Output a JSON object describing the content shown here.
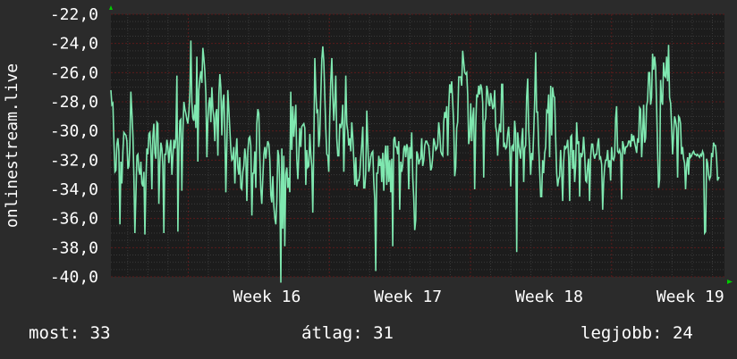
{
  "chart_data": {
    "type": "line",
    "ylabel": "onlinestream.live",
    "ylim": [
      -40,
      -22
    ],
    "yticks": [
      "-22,0",
      "-24,0",
      "-26,0",
      "-28,0",
      "-30,0",
      "-32,0",
      "-34,0",
      "-36,0",
      "-38,0",
      "-40,0"
    ],
    "xticks": [
      {
        "label": "Week 16",
        "pos": 0.126
      },
      {
        "label": "Week 17",
        "pos": 0.356
      },
      {
        "label": "Week 18",
        "pos": 0.586
      },
      {
        "label": "Week 19",
        "pos": 0.816
      }
    ],
    "grid": true,
    "colors": {
      "background": "#2b2b2b",
      "plot_bg": "#1c1c1c",
      "grid_major": "#5a1a1a",
      "grid_minor": "#3a3a3a",
      "series": "#7fe8b0",
      "arrow": "#00cc00"
    },
    "series": [
      {
        "values": [
          -27.2,
          -28.2,
          -28.1,
          -30.8,
          -32.8,
          -32.7,
          -30.9,
          -30.5,
          -31.4,
          -36.4,
          -32.1,
          -33.6,
          -31.4,
          -30.1,
          -30.2,
          -30.3,
          -30.7,
          -32.6,
          -32.4,
          -31.0,
          -27.3,
          -28.8,
          -30.3,
          -33.1,
          -37.0,
          -34.5,
          -31.7,
          -31.6,
          -32.7,
          -33.0,
          -32.1,
          -33.6,
          -33.8,
          -32.8,
          -37.1,
          -33.5,
          -31.2,
          -31.6,
          -30.2,
          -30.1,
          -31.3,
          -34.0,
          -30.4,
          -29.5,
          -31.5,
          -31.9,
          -29.4,
          -29.5,
          -35.0,
          -32.1,
          -30.8,
          -31.2,
          -32.4,
          -37.0,
          -31.6,
          -31.6,
          -30.6,
          -31.1,
          -32.2,
          -31.2,
          -30.6,
          -33.0,
          -31.7,
          -30.6,
          -31.2,
          -30.5,
          -26.2,
          -36.9,
          -31.3,
          -29.3,
          -29.2,
          -34.1,
          -30.0,
          -28.0,
          -28.5,
          -28.8,
          -29.2,
          -29.5,
          -28.7,
          -27.4,
          -23.8,
          -28.0,
          -29.1,
          -29.3,
          -28.2,
          -29.8,
          -24.9,
          -32.1,
          -27.2,
          -26.4,
          -25.9,
          -26.7,
          -24.3,
          -25.0,
          -25.9,
          -27.5,
          -31.8,
          -29.3,
          -28.1,
          -27.7,
          -29.4,
          -27.0,
          -28.5,
          -29.1,
          -30.7,
          -28.8,
          -28.5,
          -31.7,
          -27.5,
          -26.1,
          -27.0,
          -30.3,
          -28.0,
          -27.5,
          -30.2,
          -34.2,
          -31.0,
          -27.2,
          -28.6,
          -29.9,
          -31.3,
          -32.0,
          -31.9,
          -31.1,
          -33.6,
          -31.6,
          -30.5,
          -32.5,
          -33.0,
          -31.8,
          -33.9,
          -34.0,
          -32.8,
          -32.4,
          -31.2,
          -31.9,
          -34.8,
          -31.4,
          -30.5,
          -30.4,
          -31.0,
          -35.8,
          -32.9,
          -32.9,
          -31.4,
          -33.9,
          -29.5,
          -28.5,
          -28.8,
          -31.8,
          -34.0,
          -35.0,
          -33.3,
          -31.6,
          -31.1,
          -31.9,
          -31.2,
          -30.7,
          -30.9,
          -32.0,
          -34.4,
          -34.9,
          -33.1,
          -35.1,
          -36.0,
          -36.4,
          -34.8,
          -31.3,
          -31.7,
          -33.7,
          -40.4,
          -31.2,
          -36.7,
          -31.7,
          -37.9,
          -33.0,
          -32.5,
          -33.9,
          -33.2,
          -34.2,
          -27.3,
          -31.3,
          -28.3,
          -30.4,
          -29.3,
          -28.2,
          -31.9,
          -33.3,
          -31.6,
          -29.8,
          -31.1,
          -29.7,
          -29.6,
          -29.5,
          -29.8,
          -33.7,
          -31.3,
          -32.5,
          -32.4,
          -30.2,
          -31.6,
          -32.4,
          -35.6,
          -31.2,
          -25.0,
          -27.3,
          -28.7,
          -28.6,
          -31.1,
          -30.3,
          -27.5,
          -25.1,
          -24.2,
          -25.2,
          -27.5,
          -29.8,
          -31.6,
          -31.7,
          -32.8,
          -29.0,
          -26.6,
          -25.0,
          -27.6,
          -29.3,
          -28.0,
          -26.2,
          -30.5,
          -31.7,
          -31.7,
          -29.5,
          -29.8,
          -29.4,
          -28.2,
          -32.8,
          -29.8,
          -26.2,
          -29.5,
          -30.0,
          -31.0,
          -30.5,
          -31.4,
          -29.4,
          -30.4,
          -31.9,
          -33.7,
          -31.8,
          -33.8,
          -33.4,
          -33.4,
          -33.0,
          -31.8,
          -30.9,
          -29.7,
          -33.9,
          -33.9,
          -32.9,
          -28.6,
          -30.8,
          -32.8,
          -32.4,
          -31.8,
          -31.5,
          -31.4,
          -33.5,
          -34.7,
          -39.6,
          -32.9,
          -32.9,
          -31.7,
          -32.4,
          -31.9,
          -33.5,
          -31.5,
          -34.1,
          -31.7,
          -31.0,
          -33.7,
          -31.0,
          -33.5,
          -32.0,
          -34.2,
          -31.9,
          -37.9,
          -30.6,
          -30.4,
          -31.1,
          -31.1,
          -31.6,
          -30.7,
          -35.4,
          -32.1,
          -32.8,
          -32.3,
          -31.2,
          -31.0,
          -31.8,
          -30.9,
          -31.2,
          -34.0,
          -31.1,
          -31.9,
          -30.1,
          -33.2,
          -34.6,
          -36.8,
          -36.1,
          -31.4,
          -31.6,
          -32.3,
          -32.0,
          -31.9,
          -30.5,
          -32.4,
          -32.0,
          -31.0,
          -30.7,
          -30.7,
          -30.9,
          -31.0,
          -31.8,
          -32.7,
          -32.5,
          -31.8,
          -30.5,
          -30.8,
          -31.3,
          -31.2,
          -30.9,
          -29.4,
          -30.1,
          -31.4,
          -31.6,
          -31.7,
          -29.4,
          -28.7,
          -29.1,
          -28.3,
          -31.7,
          -28.4,
          -26.8,
          -27.4,
          -26.6,
          -28.1,
          -29.6,
          -33.1,
          -32.5,
          -29.8,
          -29.4,
          -26.3,
          -26.3,
          -26.3,
          -26.9,
          -24.5,
          -25.3,
          -26.0,
          -26.1,
          -26.0,
          -27.5,
          -30.9,
          -30.4,
          -28.1,
          -30.7,
          -29.1,
          -28.4,
          -34.0,
          -29.6,
          -27.5,
          -27.7,
          -26.9,
          -27.5,
          -26.8,
          -27.1,
          -28.1,
          -33.2,
          -29.4,
          -29.1,
          -26.9,
          -27.3,
          -28.1,
          -28.3,
          -27.4,
          -27.9,
          -28.5,
          -28.3,
          -27.2,
          -29.7,
          -30.1,
          -31.7,
          -30.1,
          -29.5,
          -30.1,
          -26.8,
          -26.8,
          -31.1,
          -30.9,
          -31.2,
          -31.1,
          -30.2,
          -29.7,
          -31.2,
          -33.8,
          -31.1,
          -31.0,
          -31.4,
          -29.3,
          -30.2,
          -38.3,
          -30.1,
          -30.9,
          -31.4,
          -31.9,
          -30.6,
          -29.8,
          -33.5,
          -31.2,
          -31.0,
          -27.7,
          -26.4,
          -29.9,
          -31.2,
          -33.0,
          -31.5,
          -32.0,
          -30.1,
          -27.9,
          -24.6,
          -28.7,
          -28.7,
          -31.1,
          -32.8,
          -34.5,
          -34.5,
          -32.0,
          -32.9,
          -31.5,
          -31.1,
          -28.6,
          -28.7,
          -27.5,
          -31.8,
          -26.9,
          -30.3,
          -27.0,
          -27.6,
          -27.7,
          -30.6,
          -32.9,
          -33.8,
          -33.3,
          -33.1,
          -31.3,
          -32.9,
          -34.8,
          -32.1,
          -31.0,
          -31.2,
          -31.1,
          -30.6,
          -31.8,
          -34.8,
          -30.4,
          -30.3,
          -32.6,
          -31.3,
          -33.5,
          -32.4,
          -29.4,
          -30.9,
          -30.7,
          -34.5,
          -31.5,
          -31.8,
          -31.5,
          -30.4,
          -31.6,
          -33.4,
          -33.5,
          -32.4,
          -31.9,
          -34.8,
          -31.7,
          -30.9,
          -30.9,
          -31.6,
          -31.9,
          -31.6,
          -31.6,
          -30.9,
          -30.5,
          -31.9,
          -31.8,
          -32.3,
          -35.4,
          -33.5,
          -32.5,
          -32.0,
          -32.0,
          -31.3,
          -32.5,
          -32.0,
          -33.4,
          -31.1,
          -31.9,
          -32.0,
          -31.7,
          -29.1,
          -28.3,
          -31.4,
          -31.5,
          -31.3,
          -31.6,
          -34.7,
          -30.7,
          -31.0,
          -31.6,
          -31.1,
          -31.1,
          -31.0,
          -30.7,
          -30.7,
          -31.1,
          -30.2,
          -30.7,
          -30.3,
          -30.8,
          -31.1,
          -31.5,
          -30.5,
          -30.8,
          -28.4,
          -28.5,
          -31.8,
          -30.2,
          -28.2,
          -30.8,
          -30.5,
          -28.3,
          -27.9,
          -26.0,
          -26.0,
          -28.2,
          -27.7,
          -24.7,
          -25.8,
          -24.9,
          -25.6,
          -28.2,
          -31.3,
          -33.9,
          -33.3,
          -26.5,
          -27.9,
          -28.2,
          -25.3,
          -26.2,
          -26.3,
          -24.9,
          -26.6,
          -24.1,
          -27.7,
          -28.1,
          -29.7,
          -31.6,
          -30.3,
          -29.0,
          -29.3,
          -29.8,
          -33.2,
          -29.0,
          -29.1,
          -29.5,
          -31.6,
          -31.1,
          -31.9,
          -32.2,
          -34.0,
          -32.4,
          -31.8,
          -33.0,
          -31.5,
          -31.8,
          -31.7,
          -31.5,
          -31.4,
          -31.6,
          -31.6,
          -31.7,
          -31.6,
          -31.7,
          -31.8,
          -31.6,
          -31.7,
          -31.4,
          -31.6,
          -37.0,
          -36.9,
          -31.9,
          -32.2,
          -33.0,
          -33.3,
          -33.1,
          -31.5,
          -31.8,
          -30.8,
          -31.0,
          -31.0,
          -31.9,
          -33.4,
          -33.2,
          -33.2
        ]
      }
    ],
    "gaps": [
      [
        614,
        626
      ]
    ]
  },
  "footer": {
    "now": "most: 33",
    "avg": "átlag: 31",
    "best": "legjobb: 24"
  }
}
